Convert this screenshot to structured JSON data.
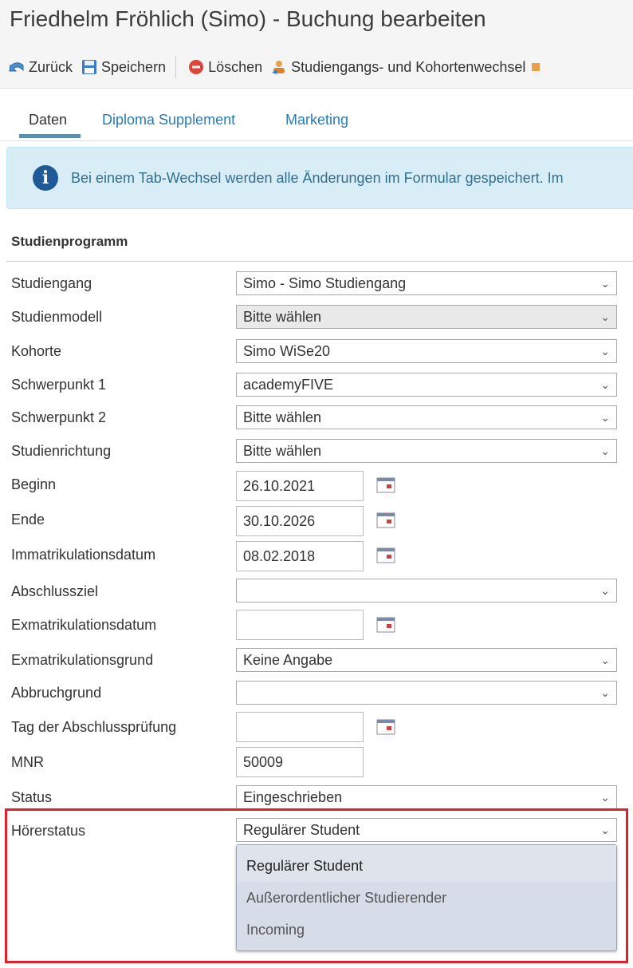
{
  "header": {
    "title": "Friedhelm Fröhlich (Simo) - Buchung bearbeiten"
  },
  "toolbar": {
    "back": {
      "label": "Zurück",
      "icon": "back-arrow-icon"
    },
    "save": {
      "label": "Speichern",
      "icon": "floppy-disk-icon"
    },
    "delete": {
      "label": "Löschen",
      "icon": "red-minus-circle-icon"
    },
    "switch": {
      "label": "Studiengangs- und Kohortenwechsel",
      "icon": "user-switch-icon"
    }
  },
  "tabs": [
    {
      "label": "Daten",
      "active": true
    },
    {
      "label": "Diploma Supplement",
      "active": false
    },
    {
      "label": "Marketing",
      "active": false
    }
  ],
  "alert": {
    "message": "Bei einem Tab-Wechsel werden alle Änderungen im Formular gespeichert. Im",
    "icon": "info-icon"
  },
  "section": {
    "title": "Studienprogramm"
  },
  "form": {
    "studiengang": {
      "label": "Studiengang",
      "value": "Simo - Simo Studiengang"
    },
    "studienmodell": {
      "label": "Studienmodell",
      "value": "Bitte wählen"
    },
    "kohorte": {
      "label": "Kohorte",
      "value": "Simo WiSe20"
    },
    "schwerpunkt1": {
      "label": "Schwerpunkt 1",
      "value": "academyFIVE"
    },
    "schwerpunkt2": {
      "label": "Schwerpunkt 2",
      "value": "Bitte wählen"
    },
    "studienrichtung": {
      "label": "Studienrichtung",
      "value": "Bitte wählen"
    },
    "beginn": {
      "label": "Beginn",
      "value": "26.10.2021"
    },
    "ende": {
      "label": "Ende",
      "value": "30.10.2026"
    },
    "immatrikulationsdatum": {
      "label": "Immatrikulationsdatum",
      "value": "08.02.2018"
    },
    "abschlussziel": {
      "label": "Abschlussziel",
      "value": ""
    },
    "exmatrikulationsdatum": {
      "label": "Exmatrikulationsdatum",
      "value": ""
    },
    "exmatrikulationsgrund": {
      "label": "Exmatrikulationsgrund",
      "value": "Keine Angabe"
    },
    "abbruchgrund": {
      "label": "Abbruchgrund",
      "value": ""
    },
    "tag_abschlusspruefung": {
      "label": "Tag der Abschlussprüfung",
      "value": ""
    },
    "mnr": {
      "label": "MNR",
      "value": "50009"
    },
    "status": {
      "label": "Status",
      "value": "Eingeschrieben"
    },
    "hoererstatus": {
      "label": "Hörerstatus",
      "value": "Regulärer Student",
      "options": [
        "Regulärer Student",
        "Außerordentlicher Studierender",
        "Incoming"
      ]
    }
  },
  "colors": {
    "highlight": "#e0202a",
    "link": "#2a7ab8",
    "alert_bg": "#d9edf7",
    "info_icon": "#1f5a96"
  }
}
